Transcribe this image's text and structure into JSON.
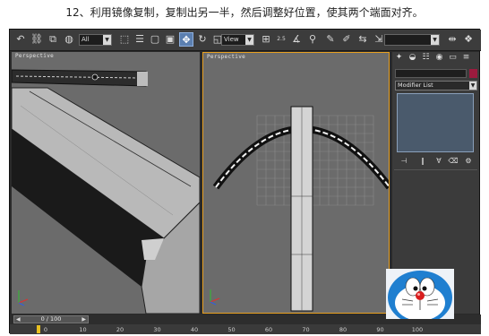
{
  "caption": "12、利用镜像复制，复制出另一半，然后调整好位置，使其两个端面对齐。",
  "toolbar": {
    "icons": [
      "undo-icon",
      "redo-icon",
      "link-icon",
      "unlink-icon",
      "bind-space-warp-icon"
    ],
    "selection_filter": "All",
    "reference_coord": "View",
    "snap_label": "2.5",
    "named_selection_value": ""
  },
  "viewports": {
    "left_label": "Perspective",
    "right_label": "Perspective"
  },
  "command_panel": {
    "tabs": [
      "create-tab",
      "modify-tab",
      "hierarchy-tab",
      "motion-tab",
      "display-tab",
      "utilities-tab"
    ],
    "modifier_list_label": "Modifier List",
    "object_color": "#9b1b3e"
  },
  "timeline": {
    "frame_readout": "0 / 100",
    "ticks": [
      "0",
      "10",
      "20",
      "30",
      "40",
      "50",
      "60",
      "70",
      "80",
      "90",
      "100"
    ]
  },
  "colors": {
    "active_viewport_border": "#e8a020",
    "viewport_bg": "#6b6b6b",
    "ui_bg": "#3c3c3c"
  }
}
